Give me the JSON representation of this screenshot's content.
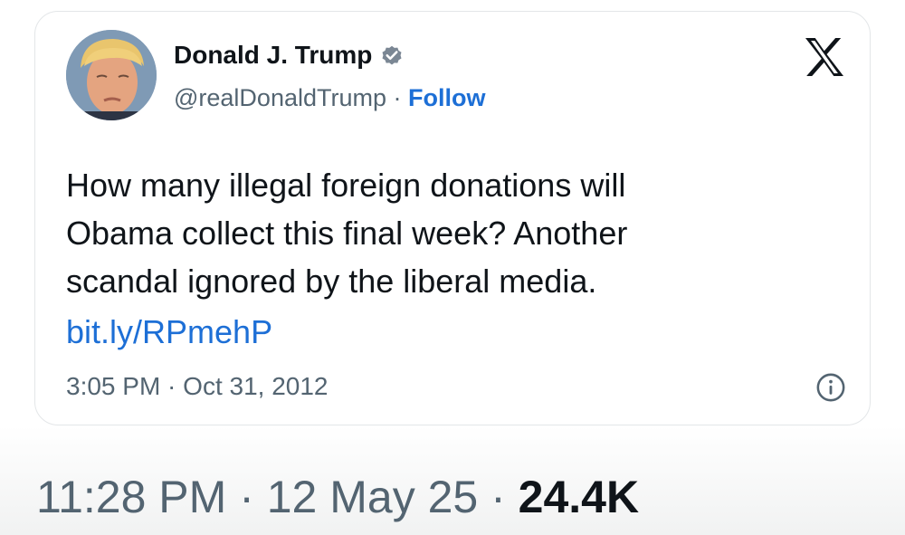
{
  "tweet": {
    "author_name": "Donald J. Trump",
    "handle": "@realDonaldTrump",
    "separator": "·",
    "follow_label": "Follow",
    "text_lines": [
      "How many illegal foreign donations will",
      "Obama collect this final week? Another",
      "scandal ignored by the liberal media."
    ],
    "link": "bit.ly/RPmehP",
    "timestamp": "3:05 PM · Oct 31, 2012",
    "icons": [
      "verified-badge-icon",
      "x-logo-icon",
      "info-icon"
    ]
  },
  "footer": {
    "time_date": "11:28 PM · 12 May 25 · ",
    "views": "24.4K"
  },
  "colors": {
    "link_blue": "#1d6fd6",
    "text_primary": "#0f1419",
    "text_secondary": "#536471",
    "verified": "#7b8794"
  }
}
